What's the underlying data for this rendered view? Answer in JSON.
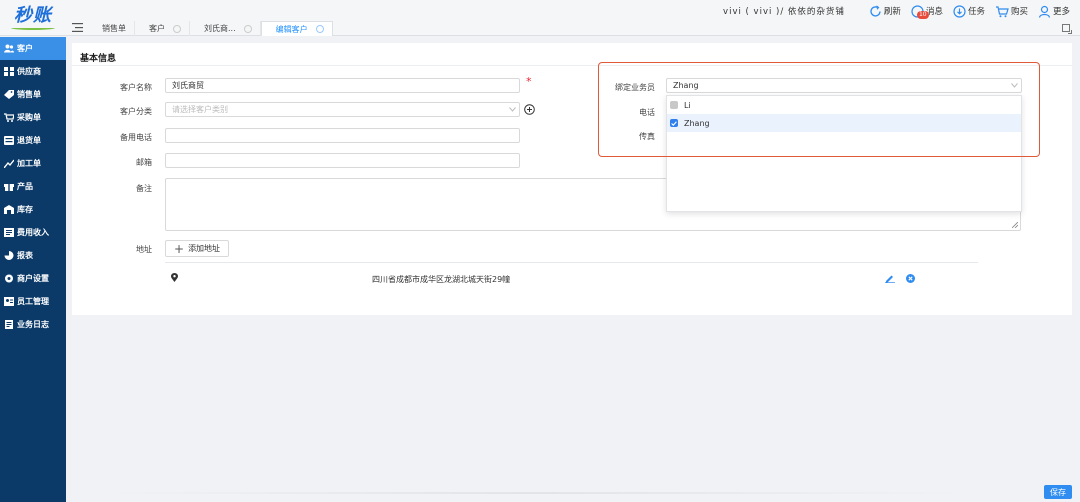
{
  "app": {
    "logo": "秒账"
  },
  "header": {
    "user_info": "vivi ( vivi )/ 依依的杂货铺",
    "actions": [
      {
        "label": "刷新",
        "icon": "refresh-icon"
      },
      {
        "label": "消息",
        "icon": "message-icon",
        "badge": "10"
      },
      {
        "label": "任务",
        "icon": "task-icon"
      },
      {
        "label": "购买",
        "icon": "cart-icon"
      },
      {
        "label": "更多",
        "icon": "user-icon"
      }
    ]
  },
  "tabs": [
    {
      "label": "销售单",
      "active": false
    },
    {
      "label": "客户",
      "active": false
    },
    {
      "label": "刘氏商...",
      "active": false
    },
    {
      "label": "编辑客户",
      "active": true
    }
  ],
  "sidebar": {
    "items": [
      {
        "label": "客户",
        "icon": "customers-icon",
        "active": true
      },
      {
        "label": "供应商",
        "icon": "supplier-icon"
      },
      {
        "label": "销售单",
        "icon": "sales-icon"
      },
      {
        "label": "采购单",
        "icon": "purchase-icon"
      },
      {
        "label": "退货单",
        "icon": "return-icon"
      },
      {
        "label": "加工单",
        "icon": "process-icon"
      },
      {
        "label": "产品",
        "icon": "product-icon"
      },
      {
        "label": "库存",
        "icon": "inventory-icon"
      },
      {
        "label": "费用收入",
        "icon": "expense-icon"
      },
      {
        "label": "报表",
        "icon": "report-icon"
      },
      {
        "label": "商户设置",
        "icon": "settings-icon"
      },
      {
        "label": "员工管理",
        "icon": "staff-icon"
      },
      {
        "label": "业务日志",
        "icon": "log-icon"
      }
    ]
  },
  "form": {
    "section_title": "基本信息",
    "customer_name": {
      "label": "客户名称",
      "value": "刘氏商贸"
    },
    "category": {
      "label": "客户分类",
      "placeholder": "请选择客户类别"
    },
    "backup_phone": {
      "label": "备用电话",
      "value": ""
    },
    "email": {
      "label": "邮箱",
      "value": ""
    },
    "remark": {
      "label": "备注",
      "value": ""
    },
    "salesperson": {
      "label": "绑定业务员",
      "value": "Zhang"
    },
    "phone": {
      "label": "电话"
    },
    "fax": {
      "label": "传真"
    },
    "address": {
      "label": "地址",
      "add_label": "添加地址",
      "entries": [
        "四川省成都市成华区龙湖北城天街29幢"
      ]
    }
  },
  "dropdown": {
    "options": [
      {
        "label": "Li",
        "checked": false
      },
      {
        "label": "Zhang",
        "checked": true
      }
    ]
  },
  "footer": {
    "save_label": "保存"
  },
  "colors": {
    "primary": "#2f8cf0",
    "sidebar": "#0b3a69",
    "sidebar_active": "#3a8fe6",
    "highlight": "#e05a3a"
  }
}
